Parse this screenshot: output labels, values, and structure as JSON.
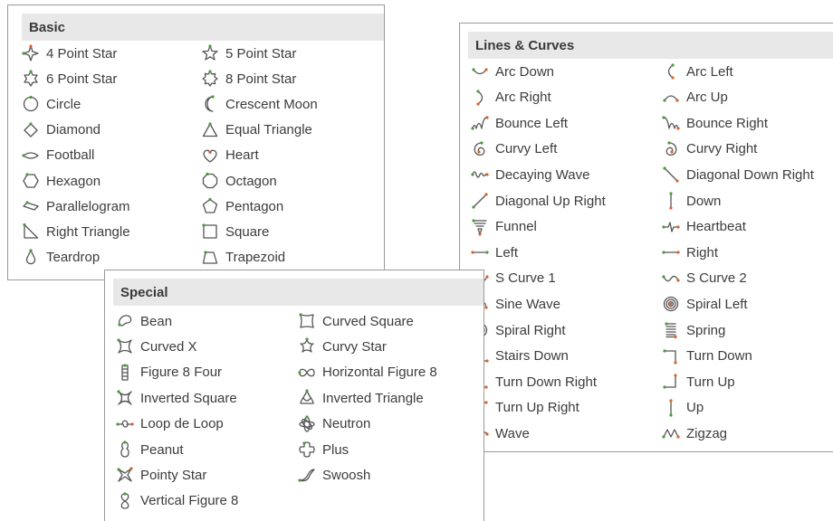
{
  "colors": {
    "icon_stroke": "#555555",
    "icon_point": "#d9622b",
    "icon_point_green": "#4a9a3a",
    "header_bg": "#e8e8e8"
  },
  "basic": {
    "title": "Basic",
    "items": [
      {
        "label": "4 Point Star",
        "icon": "star4-icon"
      },
      {
        "label": "5 Point Star",
        "icon": "star5-icon"
      },
      {
        "label": "6 Point Star",
        "icon": "star6-icon"
      },
      {
        "label": "8 Point Star",
        "icon": "star8-icon"
      },
      {
        "label": "Circle",
        "icon": "circle-icon"
      },
      {
        "label": "Crescent Moon",
        "icon": "crescent-moon-icon"
      },
      {
        "label": "Diamond",
        "icon": "diamond-icon"
      },
      {
        "label": "Equal Triangle",
        "icon": "equal-triangle-icon"
      },
      {
        "label": "Football",
        "icon": "football-icon"
      },
      {
        "label": "Heart",
        "icon": "heart-icon"
      },
      {
        "label": "Hexagon",
        "icon": "hexagon-icon"
      },
      {
        "label": "Octagon",
        "icon": "octagon-icon"
      },
      {
        "label": "Parallelogram",
        "icon": "parallelogram-icon"
      },
      {
        "label": "Pentagon",
        "icon": "pentagon-icon"
      },
      {
        "label": "Right Triangle",
        "icon": "right-triangle-icon"
      },
      {
        "label": "Square",
        "icon": "square-icon"
      },
      {
        "label": "Teardrop",
        "icon": "teardrop-icon"
      },
      {
        "label": "Trapezoid",
        "icon": "trapezoid-icon"
      }
    ]
  },
  "lines": {
    "title": "Lines & Curves",
    "items": [
      {
        "label": "Arc Down",
        "icon": "arc-down-icon"
      },
      {
        "label": "Arc Left",
        "icon": "arc-left-icon"
      },
      {
        "label": "Arc Right",
        "icon": "arc-right-icon"
      },
      {
        "label": "Arc Up",
        "icon": "arc-up-icon"
      },
      {
        "label": "Bounce Left",
        "icon": "bounce-left-icon"
      },
      {
        "label": "Bounce Right",
        "icon": "bounce-right-icon"
      },
      {
        "label": "Curvy Left",
        "icon": "curvy-left-icon"
      },
      {
        "label": "Curvy Right",
        "icon": "curvy-right-icon"
      },
      {
        "label": "Decaying Wave",
        "icon": "decaying-wave-icon"
      },
      {
        "label": "Diagonal Down Right",
        "icon": "diagonal-down-right-icon"
      },
      {
        "label": "Diagonal Up Right",
        "icon": "diagonal-up-right-icon"
      },
      {
        "label": "Down",
        "icon": "down-icon"
      },
      {
        "label": "Funnel",
        "icon": "funnel-icon"
      },
      {
        "label": "Heartbeat",
        "icon": "heartbeat-icon"
      },
      {
        "label": "Left",
        "icon": "left-icon"
      },
      {
        "label": "Right",
        "icon": "right-icon"
      },
      {
        "label": "S Curve 1",
        "icon": "s-curve-1-icon"
      },
      {
        "label": "S Curve 2",
        "icon": "s-curve-2-icon"
      },
      {
        "label": "Sine Wave",
        "icon": "sine-wave-icon"
      },
      {
        "label": "Spiral Left",
        "icon": "spiral-left-icon"
      },
      {
        "label": "Spiral Right",
        "icon": "spiral-right-icon"
      },
      {
        "label": "Spring",
        "icon": "spring-icon"
      },
      {
        "label": "Stairs Down",
        "icon": "stairs-down-icon"
      },
      {
        "label": "Turn Down",
        "icon": "turn-down-icon"
      },
      {
        "label": "Turn Down Right",
        "icon": "turn-down-right-icon"
      },
      {
        "label": "Turn Up",
        "icon": "turn-up-icon"
      },
      {
        "label": "Turn Up Right",
        "icon": "turn-up-right-icon"
      },
      {
        "label": "Up",
        "icon": "up-icon"
      },
      {
        "label": "Wave",
        "icon": "wave-icon"
      },
      {
        "label": "Zigzag",
        "icon": "zigzag-icon"
      }
    ]
  },
  "special": {
    "title": "Special",
    "items": [
      {
        "label": "Bean",
        "icon": "bean-icon"
      },
      {
        "label": "Curved Square",
        "icon": "curved-square-icon"
      },
      {
        "label": "Curved X",
        "icon": "curved-x-icon"
      },
      {
        "label": "Curvy Star",
        "icon": "curvy-star-icon"
      },
      {
        "label": "Figure 8 Four",
        "icon": "figure-8-four-icon"
      },
      {
        "label": "Horizontal Figure 8",
        "icon": "horizontal-figure-8-icon"
      },
      {
        "label": "Inverted Square",
        "icon": "inverted-square-icon"
      },
      {
        "label": "Inverted Triangle",
        "icon": "inverted-triangle-icon"
      },
      {
        "label": "Loop de Loop",
        "icon": "loop-de-loop-icon"
      },
      {
        "label": "Neutron",
        "icon": "neutron-icon"
      },
      {
        "label": "Peanut",
        "icon": "peanut-icon"
      },
      {
        "label": "Plus",
        "icon": "plus-icon"
      },
      {
        "label": "Pointy Star",
        "icon": "pointy-star-icon"
      },
      {
        "label": "Swoosh",
        "icon": "swoosh-icon"
      },
      {
        "label": "Vertical Figure 8",
        "icon": "vertical-figure-8-icon"
      }
    ]
  }
}
